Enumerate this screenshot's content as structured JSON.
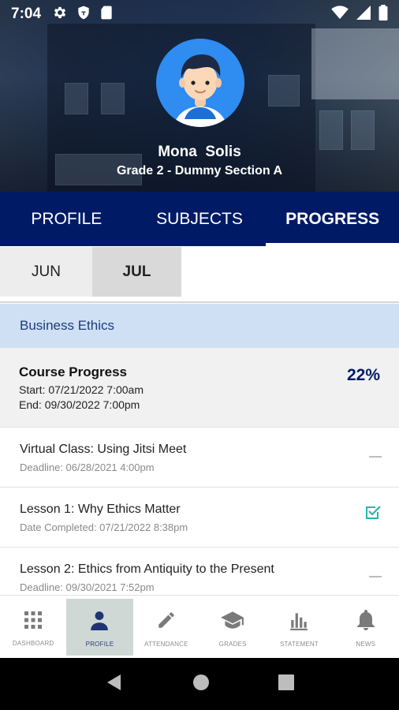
{
  "status_bar": {
    "time": "7:04",
    "icons_left": [
      "gear-icon",
      "shield-icon",
      "sd-card-icon"
    ],
    "icons_right": [
      "wifi-icon",
      "signal-icon",
      "battery-icon"
    ]
  },
  "profile": {
    "name": "Mona  Solis",
    "grade_section": "Grade 2 - Dummy Section A",
    "avatar": "student-avatar"
  },
  "tabs": [
    {
      "label": "PROFILE",
      "active": false
    },
    {
      "label": "SUBJECTS",
      "active": false
    },
    {
      "label": "PROGRESS",
      "active": true
    }
  ],
  "months": [
    {
      "label": "JUN",
      "active": false
    },
    {
      "label": "JUL",
      "active": true
    }
  ],
  "subject": "Business Ethics",
  "course_progress": {
    "title": "Course Progress",
    "start": "Start: 07/21/2022 7:00am",
    "end": "End: 09/30/2022 7:00pm",
    "percent": "22%"
  },
  "lessons": [
    {
      "title": "Virtual Class: Using Jitsi Meet",
      "detail": "Deadline: 06/28/2021 4:00pm",
      "status": "pending",
      "status_icon": "dash-icon"
    },
    {
      "title": "Lesson 1: Why Ethics Matter",
      "detail": "Date Completed: 07/21/2022 8:38pm",
      "status": "completed",
      "status_icon": "check-box-icon"
    },
    {
      "title": "Lesson 2: Ethics from Antiquity to the Present",
      "detail": "Deadline: 09/30/2021 7:52pm",
      "status": "pending",
      "status_icon": "dash-icon"
    }
  ],
  "bottom_nav": [
    {
      "label": "DASHBOARD",
      "icon": "grid-icon",
      "active": false
    },
    {
      "label": "PROFILE",
      "icon": "person-icon",
      "active": true
    },
    {
      "label": "ATTENDANCE",
      "icon": "pencil-icon",
      "active": false
    },
    {
      "label": "GRADES",
      "icon": "graduation-cap-icon",
      "active": false
    },
    {
      "label": "STATEMENT",
      "icon": "bar-chart-icon",
      "active": false
    },
    {
      "label": "NEWS",
      "icon": "bell-icon",
      "active": false
    }
  ],
  "system_nav": [
    "back-icon",
    "home-icon",
    "recents-icon"
  ],
  "colors": {
    "primary_navy": "#001a66",
    "subject_bar": "#cfe0f5",
    "check_teal": "#1fb8b0",
    "active_nav_bg": "#cfd8d5"
  }
}
